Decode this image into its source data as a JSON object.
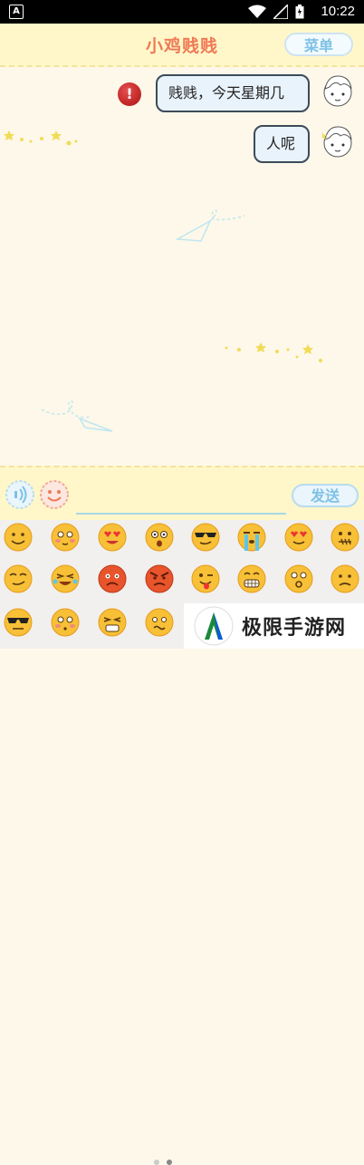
{
  "status_bar": {
    "time": "10:22"
  },
  "header": {
    "title": "小鸡贱贱",
    "menu_label": "菜单"
  },
  "chat": {
    "messages": [
      {
        "text": "贱贱，今天星期几",
        "status": "error"
      },
      {
        "text": "人呢",
        "status": "sent"
      }
    ]
  },
  "input_bar": {
    "input_value": "",
    "send_label": "发送"
  },
  "emoji_panel": {
    "rows": [
      [
        "smile-icon",
        "shy-icon",
        "heart-eyes-icon",
        "shocked-icon",
        "cool-sunglasses-icon",
        "crying-icon",
        "in-love-icon",
        "zipped-mouth-icon"
      ],
      [
        "smirk-icon",
        "laughing-tears-icon",
        "angry-red-icon",
        "furious-icon",
        "wink-tongue-icon",
        "grin-icon",
        "surprised-icon",
        "sad-icon"
      ],
      [
        "sunglasses-icon",
        "blushing-icon",
        "frustrated-icon",
        "confused-icon"
      ]
    ],
    "page_dots": 2,
    "active_page": 2
  },
  "watermark": {
    "text": "极限手游网"
  },
  "colors": {
    "accent": "#7ec2e6",
    "title": "#ef7a55",
    "bubble_border": "#3d4b5a",
    "header_bg": "#fff7c9"
  }
}
